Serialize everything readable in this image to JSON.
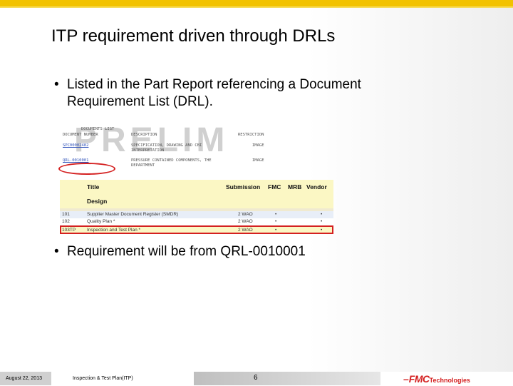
{
  "slide": {
    "title": "ITP requirement driven through DRLs",
    "bullets": [
      "Listed in the Part Report referencing a Document Requirement List (DRL).",
      "Requirement will be from QRL-0010001"
    ],
    "bullet_glyph": "•"
  },
  "embedded_image": {
    "watermark": "PRELIM",
    "scan_header": {
      "top": "DOCUMENTS LIST",
      "col_number": "DOCUMENT NUMBER",
      "col_description": "DESCRIPTION",
      "col_restriction": "RESTRICTION"
    },
    "scan_rows": [
      {
        "number": "SPC00002482",
        "description": "SPECIFICATION, DRAWING AND CBI",
        "description2": "INTERPRETATION",
        "restriction": "IMAGE"
      },
      {
        "number": "QRL-0010001",
        "description": "PRESSURE CONTAINED COMPONENTS, THE",
        "description2": "DEPARTMENT",
        "restriction": "IMAGE"
      }
    ],
    "drl_table": {
      "headers": {
        "title": "Title",
        "submission": "Submission",
        "fmc": "FMC",
        "mrb": "MRB",
        "vendor": "Vendor"
      },
      "section": "Design",
      "rows": [
        {
          "code": "101",
          "title": "Supplier Master Document Register (SMDR)",
          "submission": "2 WAO",
          "fmc": "•",
          "mrb": "",
          "vendor": "•"
        },
        {
          "code": "102",
          "title": "Quality Plan *",
          "submission": "2 WAO",
          "fmc": "•",
          "mrb": "",
          "vendor": "•"
        },
        {
          "code": "103TP",
          "title": "Inspection and Test Plan *",
          "submission": "2 WAO",
          "fmc": "•",
          "mrb": "",
          "vendor": "•"
        }
      ]
    }
  },
  "footer": {
    "date": "August 22, 2013",
    "doc_title": "Inspection & Test Plan(ITP)",
    "page_number": "6",
    "logo_main": "FMC",
    "logo_sub": "Technologies"
  },
  "colors": {
    "top_bar": "#f2c200",
    "highlight": "#d42020",
    "table_yellow": "#fbf7c4",
    "logo_red": "#d42020"
  }
}
